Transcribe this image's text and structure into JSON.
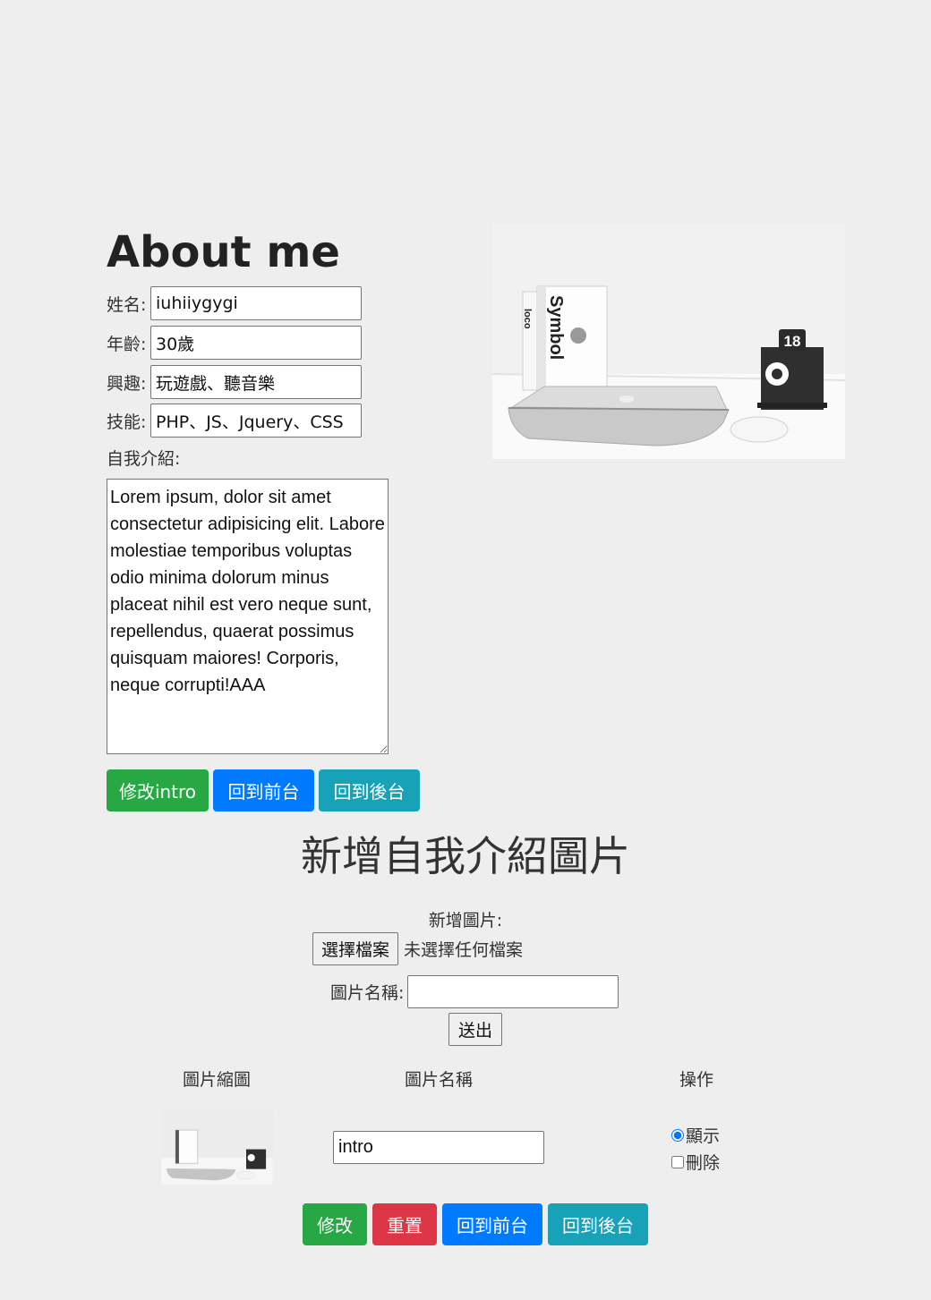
{
  "about": {
    "title": "About me",
    "fields": [
      {
        "label": "姓名:",
        "value": "iuhiiygygi"
      },
      {
        "label": "年齡:",
        "value": "30歲"
      },
      {
        "label": "興趣:",
        "value": "玩遊戲、聽音樂"
      },
      {
        "label": "技能:",
        "value": "PHP、JS、Jquery、CSS"
      }
    ],
    "intro_label": "自我介紹:",
    "intro_text": "Lorem ipsum, dolor sit amet consectetur adipisicing elit. Labore molestiae temporibus voluptas odio minima dolorum minus placeat nihil est vero neque sunt, repellendus, quaerat possimus quisquam maiores! Corporis, neque corrupti!AAA",
    "buttons": {
      "edit": "修改intro",
      "front": "回到前台",
      "back": "回到後台"
    },
    "image": {
      "book_title": "Symbol",
      "book_sub": "loco",
      "calendar_day": "18"
    }
  },
  "upload": {
    "title": "新增自我介紹圖片",
    "add_label": "新增圖片:",
    "choose_file": "選擇檔案",
    "no_file": "未選擇任何檔案",
    "name_label": "圖片名稱:",
    "name_value": "",
    "submit": "送出"
  },
  "table": {
    "headers": [
      "圖片縮圖",
      "圖片名稱",
      "操作"
    ],
    "rows": [
      {
        "name": "intro",
        "show_label": "顯示",
        "show_checked": true,
        "delete_label": "刪除",
        "delete_checked": false
      }
    ]
  },
  "actions": {
    "edit": "修改",
    "reset": "重置",
    "front": "回到前台",
    "back": "回到後台"
  },
  "colors": {
    "green": "#28a745",
    "blue": "#007bff",
    "teal": "#17a2b8",
    "red": "#dc3545",
    "background": "#eeeeee"
  }
}
